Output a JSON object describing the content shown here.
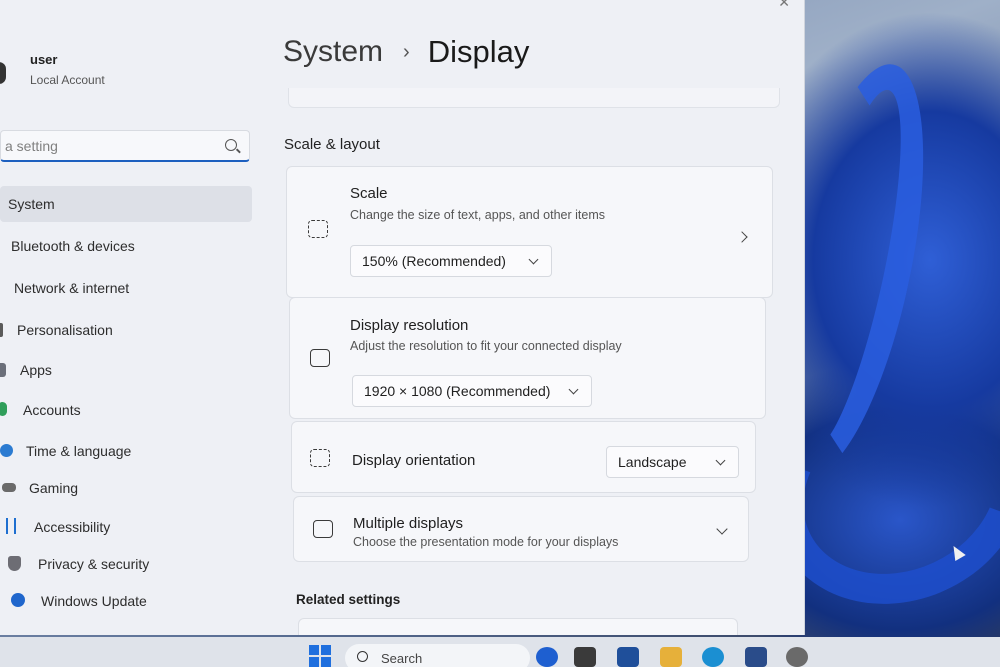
{
  "sidebar": {
    "user": {
      "name": "user",
      "account_type": "Local Account"
    },
    "search_placeholder": "a setting",
    "items": [
      {
        "label": "System",
        "icon": "monitor-icon",
        "active": true
      },
      {
        "label": "Bluetooth & devices",
        "icon": "bluetooth-icon"
      },
      {
        "label": "Network & internet",
        "icon": "wifi-icon"
      },
      {
        "label": "Personalisation",
        "icon": "brush-icon"
      },
      {
        "label": "Apps",
        "icon": "apps-icon"
      },
      {
        "label": "Accounts",
        "icon": "person-icon"
      },
      {
        "label": "Time & language",
        "icon": "globe-icon"
      },
      {
        "label": "Gaming",
        "icon": "gamepad-icon"
      },
      {
        "label": "Accessibility",
        "icon": "accessibility-icon"
      },
      {
        "label": "Privacy & security",
        "icon": "shield-icon"
      },
      {
        "label": "Windows Update",
        "icon": "update-icon"
      }
    ]
  },
  "breadcrumb": {
    "parent": "System",
    "separator": "›",
    "current": "Display"
  },
  "section_title": "Scale & layout",
  "cards": {
    "scale": {
      "title": "Scale",
      "description": "Change the size of text, apps, and other items",
      "value": "150% (Recommended)"
    },
    "resolution": {
      "title": "Display resolution",
      "description": "Adjust the resolution to fit your connected display",
      "value": "1920 × 1080 (Recommended)"
    },
    "orientation": {
      "title": "Display orientation",
      "value": "Landscape"
    },
    "multiple": {
      "title": "Multiple displays",
      "description": "Choose the presentation mode for your displays"
    }
  },
  "related_title": "Related settings",
  "taskbar": {
    "search_label": "Search"
  },
  "colors": {
    "accent": "#1c5fbf",
    "window_bg": "#eef0f5",
    "card_bg": "#f6f7fa"
  }
}
